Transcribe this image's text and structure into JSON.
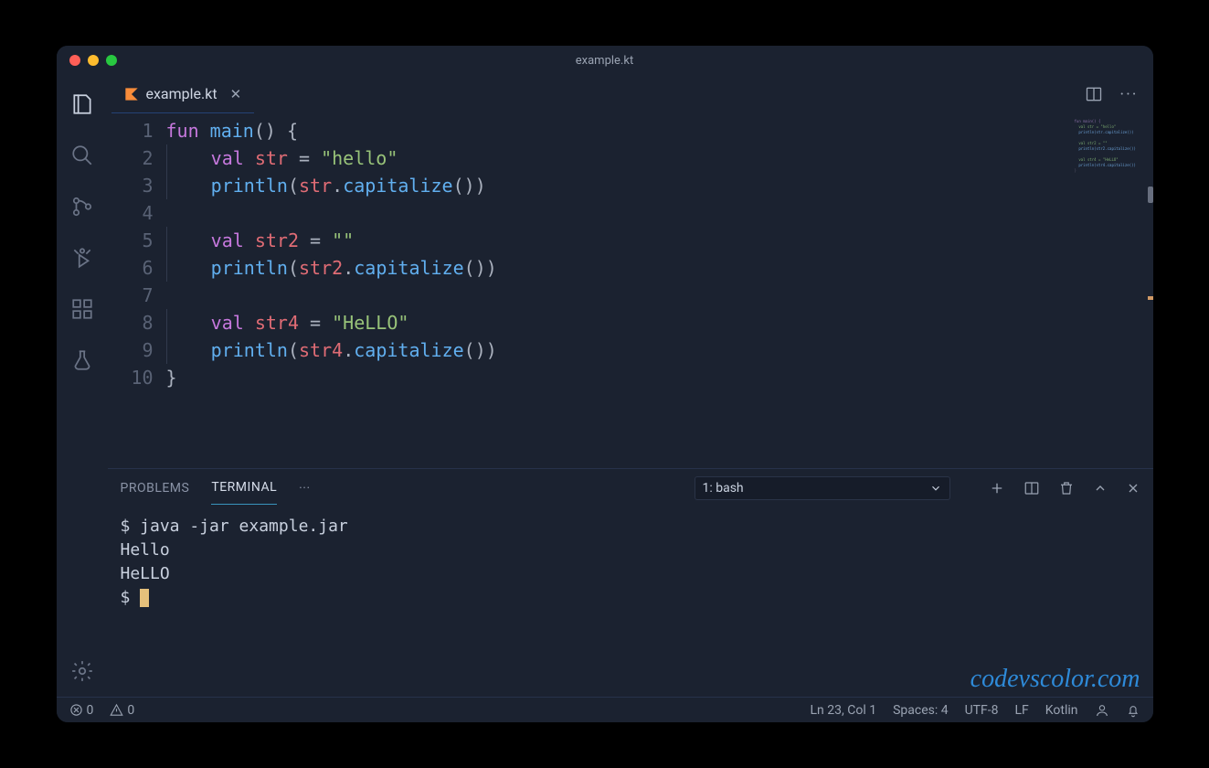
{
  "window": {
    "title": "example.kt"
  },
  "activity": {
    "items": [
      "explorer",
      "search",
      "source-control",
      "debug",
      "extensions",
      "testing"
    ],
    "bottom": [
      "settings"
    ]
  },
  "tab": {
    "filename": "example.kt"
  },
  "editor": {
    "lineNumbers": [
      "1",
      "2",
      "3",
      "4",
      "5",
      "6",
      "7",
      "8",
      "9",
      "10"
    ],
    "lines": [
      [
        {
          "t": "fun ",
          "c": "tok-kw"
        },
        {
          "t": "main",
          "c": "tok-fn"
        },
        {
          "t": "() {",
          "c": "tok-pn"
        }
      ],
      [
        {
          "t": "    ",
          "c": ""
        },
        {
          "t": "val ",
          "c": "tok-kw"
        },
        {
          "t": "str",
          "c": "tok-id"
        },
        {
          "t": " = ",
          "c": "tok-op"
        },
        {
          "t": "\"hello\"",
          "c": "tok-str"
        }
      ],
      [
        {
          "t": "    ",
          "c": ""
        },
        {
          "t": "println",
          "c": "tok-fn"
        },
        {
          "t": "(",
          "c": "tok-pn"
        },
        {
          "t": "str",
          "c": "tok-id"
        },
        {
          "t": ".",
          "c": "tok-pn"
        },
        {
          "t": "capitalize",
          "c": "tok-fn"
        },
        {
          "t": "())",
          "c": "tok-pn"
        }
      ],
      [
        {
          "t": "",
          "c": ""
        }
      ],
      [
        {
          "t": "    ",
          "c": ""
        },
        {
          "t": "val ",
          "c": "tok-kw"
        },
        {
          "t": "str2",
          "c": "tok-id"
        },
        {
          "t": " = ",
          "c": "tok-op"
        },
        {
          "t": "\"\"",
          "c": "tok-str"
        }
      ],
      [
        {
          "t": "    ",
          "c": ""
        },
        {
          "t": "println",
          "c": "tok-fn"
        },
        {
          "t": "(",
          "c": "tok-pn"
        },
        {
          "t": "str2",
          "c": "tok-id"
        },
        {
          "t": ".",
          "c": "tok-pn"
        },
        {
          "t": "capitalize",
          "c": "tok-fn"
        },
        {
          "t": "())",
          "c": "tok-pn"
        }
      ],
      [
        {
          "t": "",
          "c": ""
        }
      ],
      [
        {
          "t": "    ",
          "c": ""
        },
        {
          "t": "val ",
          "c": "tok-kw"
        },
        {
          "t": "str4",
          "c": "tok-id"
        },
        {
          "t": " = ",
          "c": "tok-op"
        },
        {
          "t": "\"HeLLO\"",
          "c": "tok-str"
        }
      ],
      [
        {
          "t": "    ",
          "c": ""
        },
        {
          "t": "println",
          "c": "tok-fn"
        },
        {
          "t": "(",
          "c": "tok-pn"
        },
        {
          "t": "str4",
          "c": "tok-id"
        },
        {
          "t": ".",
          "c": "tok-pn"
        },
        {
          "t": "capitalize",
          "c": "tok-fn"
        },
        {
          "t": "())",
          "c": "tok-pn"
        }
      ],
      [
        {
          "t": "}",
          "c": "tok-pn"
        }
      ]
    ]
  },
  "panel": {
    "tabs": {
      "problems": "PROBLEMS",
      "terminal": "TERMINAL",
      "more": "···"
    },
    "terminalSelector": "1: bash",
    "output": [
      "$ java -jar example.jar",
      "Hello",
      "",
      "HeLLO",
      "$ "
    ]
  },
  "watermark": "codevscolor.com",
  "status": {
    "errors": "0",
    "warnings": "0",
    "cursor": "Ln 23, Col 1",
    "spaces": "Spaces: 4",
    "encoding": "UTF-8",
    "eol": "LF",
    "language": "Kotlin"
  }
}
